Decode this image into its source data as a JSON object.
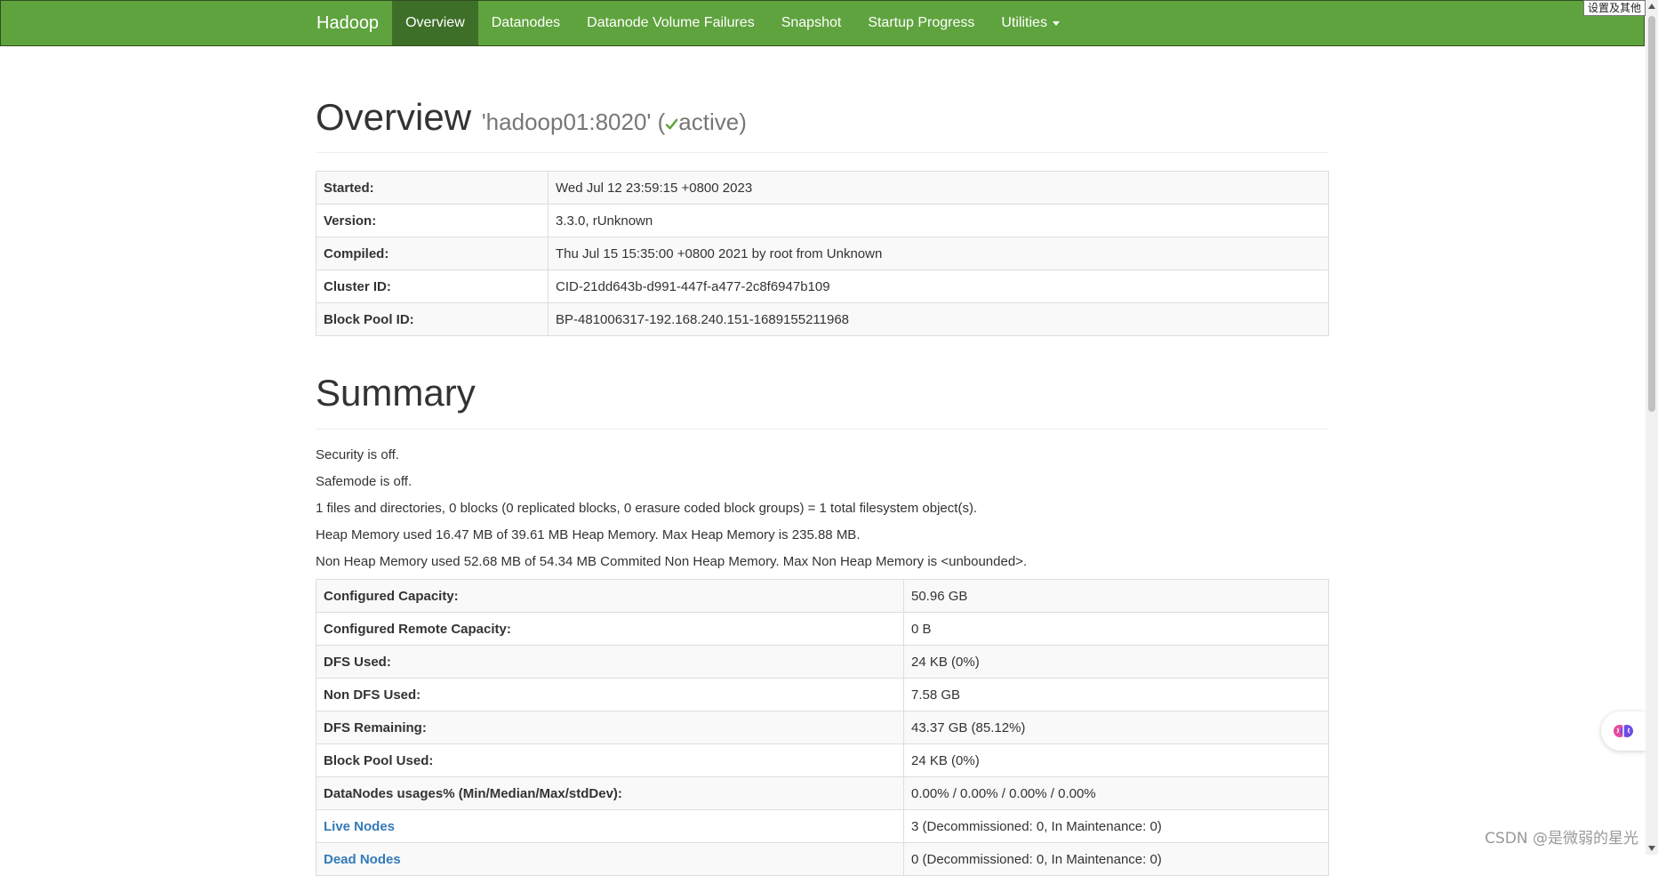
{
  "nav": {
    "brand": "Hadoop",
    "items": [
      {
        "label": "Overview",
        "active": true
      },
      {
        "label": "Datanodes"
      },
      {
        "label": "Datanode Volume Failures"
      },
      {
        "label": "Snapshot"
      },
      {
        "label": "Startup Progress"
      },
      {
        "label": "Utilities"
      }
    ]
  },
  "overview": {
    "title": "Overview",
    "host": "'hadoop01:8020' (",
    "state": "active",
    "state_close": ")",
    "rows": [
      {
        "key": "Started:",
        "value": "Wed Jul 12 23:59:15 +0800 2023"
      },
      {
        "key": "Version:",
        "value": "3.3.0, rUnknown"
      },
      {
        "key": "Compiled:",
        "value": "Thu Jul 15 15:35:00 +0800 2021 by root from Unknown"
      },
      {
        "key": "Cluster ID:",
        "value": "CID-21dd643b-d991-447f-a477-2c8f6947b109"
      },
      {
        "key": "Block Pool ID:",
        "value": "BP-481006317-192.168.240.151-1689155211968"
      }
    ]
  },
  "summary": {
    "title": "Summary",
    "lines": [
      "Security is off.",
      "Safemode is off.",
      "1 files and directories, 0 blocks (0 replicated blocks, 0 erasure coded block groups) = 1 total filesystem object(s).",
      "Heap Memory used 16.47 MB of 39.61 MB Heap Memory. Max Heap Memory is 235.88 MB.",
      "Non Heap Memory used 52.68 MB of 54.34 MB Commited Non Heap Memory. Max Non Heap Memory is <unbounded>."
    ],
    "rows": [
      {
        "key": "Configured Capacity:",
        "value": "50.96 GB"
      },
      {
        "key": "Configured Remote Capacity:",
        "value": "0 B"
      },
      {
        "key": "DFS Used:",
        "value": "24 KB (0%)"
      },
      {
        "key": "Non DFS Used:",
        "value": "7.58 GB"
      },
      {
        "key": "DFS Remaining:",
        "value": "43.37 GB (85.12%)"
      },
      {
        "key": "Block Pool Used:",
        "value": "24 KB (0%)"
      },
      {
        "key": "DataNodes usages% (Min/Median/Max/stdDev):",
        "value": "0.00% / 0.00% / 0.00% / 0.00%"
      },
      {
        "key": "Live Nodes",
        "value": "3 (Decommissioned: 0, In Maintenance: 0)"
      },
      {
        "key": "Dead Nodes",
        "value": "0 (Decommissioned: 0, In Maintenance: 0)"
      }
    ]
  },
  "overlay": {
    "tooltip": "设置及其他",
    "watermark": "CSDN @是微弱的星光"
  },
  "colors": {
    "navbar": "#5fa33e",
    "nav_active": "#3e6f29",
    "link": "#337ab7",
    "active_check": "#5fa33e"
  }
}
